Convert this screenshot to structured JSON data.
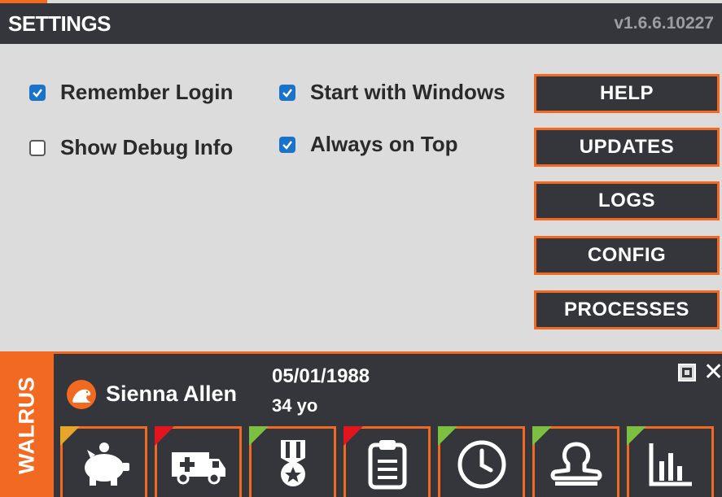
{
  "header": {
    "title": "SETTINGS",
    "version": "v1.6.6.10227"
  },
  "options": [
    {
      "label": "Remember Login",
      "checked": true
    },
    {
      "label": "Show Debug Info",
      "checked": false
    },
    {
      "label": "Start with Windows",
      "checked": true
    },
    {
      "label": "Always on Top",
      "checked": true
    }
  ],
  "buttons": {
    "help": "HELP",
    "updates": "UPDATES",
    "logs": "LOGS",
    "config": "CONFIG",
    "processes": "PROCESSES"
  },
  "patient": {
    "brand": "WALRUS",
    "name": "Sienna Allen",
    "dob": "05/01/1988",
    "age": "34 yo"
  },
  "colors": {
    "accent": "#f26a21",
    "dark": "#34363b",
    "check": "#1a73c9",
    "flag_yellow": "#e8a628",
    "flag_red": "#e4141e",
    "flag_green": "#7cc042"
  },
  "tiles": [
    {
      "icon": "piggy-bank-icon",
      "flag": "yellow"
    },
    {
      "icon": "ambulance-icon",
      "flag": "red"
    },
    {
      "icon": "medal-icon",
      "flag": "green"
    },
    {
      "icon": "clipboard-icon",
      "flag": "red"
    },
    {
      "icon": "clock-icon",
      "flag": "green"
    },
    {
      "icon": "stamp-icon",
      "flag": "green"
    },
    {
      "icon": "bar-chart-icon",
      "flag": "green"
    }
  ]
}
